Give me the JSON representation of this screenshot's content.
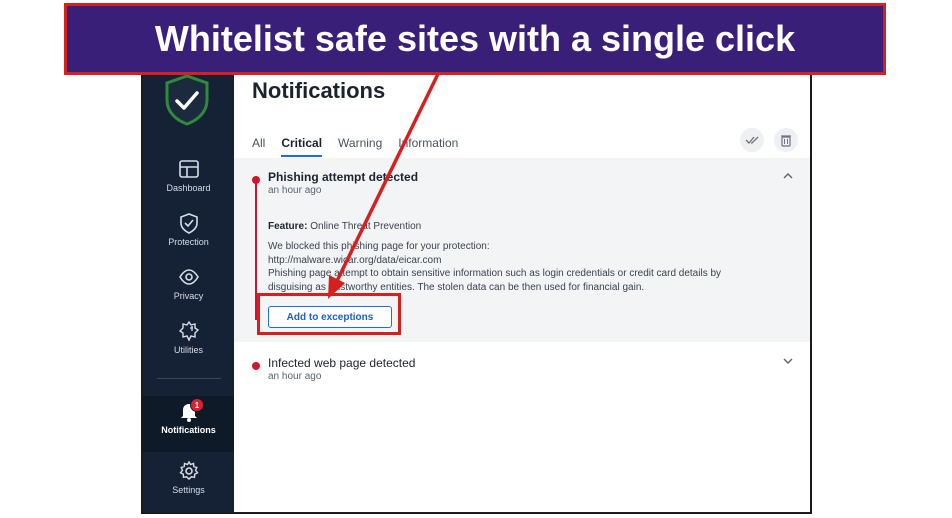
{
  "banner": {
    "text": "Whitelist safe sites with a single click"
  },
  "sidebar": {
    "items": [
      {
        "label": "Dashboard"
      },
      {
        "label": "Protection"
      },
      {
        "label": "Privacy"
      },
      {
        "label": "Utilities"
      },
      {
        "label": "Notifications",
        "badge": "1"
      },
      {
        "label": "Settings"
      }
    ]
  },
  "main": {
    "title": "Notifications",
    "tabs": [
      {
        "label": "All"
      },
      {
        "label": "Critical"
      },
      {
        "label": "Warning"
      },
      {
        "label": "Information"
      }
    ],
    "active_tab": "Critical"
  },
  "notifications": [
    {
      "title": "Phishing attempt detected",
      "time": "an hour ago",
      "feature_label": "Feature:",
      "feature_value": "Online Threat Prevention",
      "line1": "We blocked this phishing page for your protection:",
      "line2": "http://malware.wicar.org/data/eicar.com",
      "line3": "Phishing page attempt to obtain sensitive information such as login credentials or credit card details by",
      "line4": "disguising as trustworthy entities. The stolen data can be then used for financial gain.",
      "button_label": "Add to exceptions"
    },
    {
      "title": "Infected web page detected",
      "time": "an hour ago"
    }
  ],
  "colors": {
    "sidebar": "#152235",
    "accent": "#1e6fd9",
    "critical": "#d4142c",
    "banner": "#3a1f78",
    "highlight": "#d62020",
    "shield": "#2e8b3a"
  }
}
